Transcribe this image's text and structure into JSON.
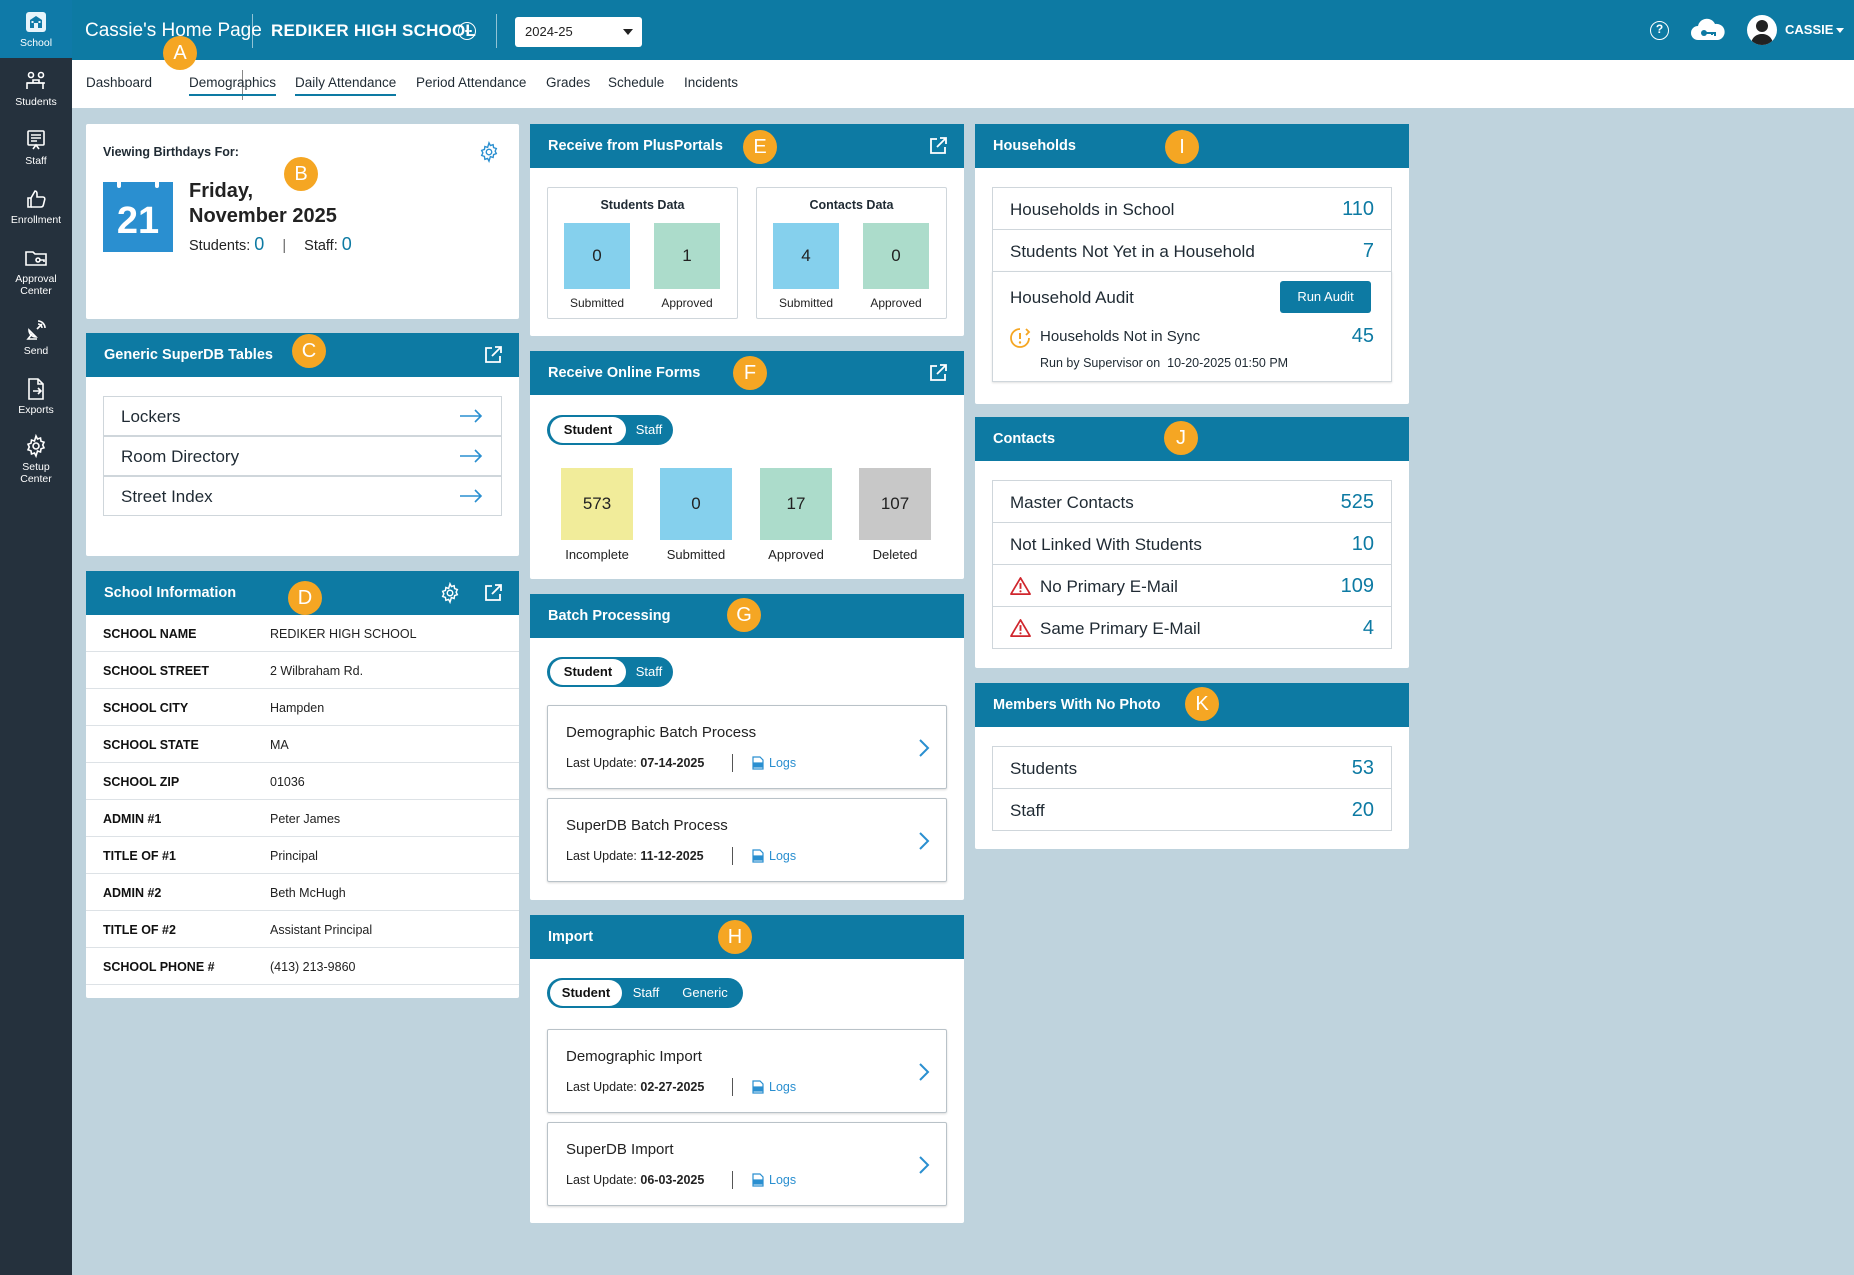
{
  "rail": {
    "items": [
      {
        "label": "School",
        "icon": "school-icon"
      },
      {
        "label": "Students",
        "icon": "students-icon"
      },
      {
        "label": "Staff",
        "icon": "staff-icon"
      },
      {
        "label": "Enrollment",
        "icon": "thumbs-up-icon"
      },
      {
        "label_line1": "Approval",
        "label_line2": "Center",
        "icon": "folder-key-icon"
      },
      {
        "label": "Send",
        "icon": "satellite-icon"
      },
      {
        "label": "Exports",
        "icon": "export-file-icon"
      },
      {
        "label_line1": "Setup",
        "label_line2": "Center",
        "icon": "gear-icon"
      }
    ]
  },
  "topbar": {
    "home_title": "Cassie's Home Page",
    "school_name": "REDIKER HIGH SCHOOL",
    "year": "2024-25",
    "user": "CASSIE",
    "help": "?"
  },
  "tabs": [
    "Dashboard",
    "Demographics",
    "Daily Attendance",
    "Period Attendance",
    "Grades",
    "Schedule",
    "Incidents"
  ],
  "badges": {
    "a": "A",
    "b": "B",
    "c": "C",
    "d": "D",
    "e": "E",
    "f": "F",
    "g": "G",
    "h": "H",
    "i": "I",
    "j": "J",
    "k": "K"
  },
  "birthdays": {
    "label": "Viewing Birthdays For:",
    "day": "21",
    "weekday": "Friday,",
    "month_year": "November 2025",
    "students_label": "Students:",
    "students": "0",
    "sep": "|",
    "staff_label": "Staff:",
    "staff": "0"
  },
  "superdb": {
    "title": "Generic SuperDB Tables",
    "items": [
      "Lockers",
      "Room Directory",
      "Street Index"
    ]
  },
  "school_info": {
    "title": "School Information",
    "rows": [
      {
        "k": "SCHOOL NAME",
        "v": "REDIKER HIGH SCHOOL"
      },
      {
        "k": "SCHOOL STREET",
        "v": "2 Wilbraham Rd."
      },
      {
        "k": "SCHOOL CITY",
        "v": "Hampden"
      },
      {
        "k": "SCHOOL STATE",
        "v": "MA"
      },
      {
        "k": "SCHOOL ZIP",
        "v": "01036"
      },
      {
        "k": "ADMIN #1",
        "v": "Peter James"
      },
      {
        "k": "TITLE OF #1",
        "v": "Principal"
      },
      {
        "k": "ADMIN #2",
        "v": "Beth McHugh"
      },
      {
        "k": "TITLE OF #2",
        "v": "Assistant Principal"
      },
      {
        "k": "SCHOOL PHONE #",
        "v": "(413) 213-9860"
      }
    ]
  },
  "plusportals": {
    "title": "Receive from PlusPortals",
    "students": {
      "title": "Students Data",
      "submitted": "0",
      "approved": "1",
      "submitted_label": "Submitted",
      "approved_label": "Approved"
    },
    "contacts": {
      "title": "Contacts Data",
      "submitted": "4",
      "approved": "0",
      "submitted_label": "Submitted",
      "approved_label": "Approved"
    }
  },
  "online_forms": {
    "title": "Receive Online Forms",
    "toggle": [
      "Student",
      "Staff"
    ],
    "tiles": [
      {
        "value": "573",
        "label": "Incomplete"
      },
      {
        "value": "0",
        "label": "Submitted"
      },
      {
        "value": "17",
        "label": "Approved"
      },
      {
        "value": "107",
        "label": "Deleted"
      }
    ]
  },
  "batch": {
    "title": "Batch Processing",
    "toggle": [
      "Student",
      "Staff"
    ],
    "items": [
      {
        "title": "Demographic Batch Process",
        "update_label": "Last Update:",
        "date": "07-14-2025",
        "logs": "Logs"
      },
      {
        "title": "SuperDB Batch Process",
        "update_label": "Last Update:",
        "date": "11-12-2025",
        "logs": "Logs"
      }
    ]
  },
  "import": {
    "title": "Import",
    "toggle": [
      "Student",
      "Staff",
      "Generic"
    ],
    "items": [
      {
        "title": "Demographic Import",
        "update_label": "Last Update:",
        "date": "02-27-2025",
        "logs": "Logs"
      },
      {
        "title": "SuperDB Import",
        "update_label": "Last Update:",
        "date": "06-03-2025",
        "logs": "Logs"
      }
    ]
  },
  "households": {
    "title": "Households",
    "in_school": {
      "label": "Households in School",
      "value": "110"
    },
    "not_in_household": {
      "label": "Students Not Yet in a Household",
      "value": "7"
    },
    "audit": {
      "label": "Household Audit",
      "button": "Run Audit",
      "sync_label": "Households Not in Sync",
      "sync_value": "45",
      "run_by": "Run by Supervisor on",
      "run_at": "10-20-2025 01:50 PM"
    }
  },
  "contacts": {
    "title": "Contacts",
    "rows": [
      {
        "label": "Master Contacts",
        "value": "525"
      },
      {
        "label": "Not Linked With Students",
        "value": "10"
      },
      {
        "label": "No Primary E-Mail",
        "value": "109"
      },
      {
        "label": "Same Primary E-Mail",
        "value": "4"
      }
    ]
  },
  "no_photo": {
    "title": "Members With No Photo",
    "rows": [
      {
        "label": "Students",
        "value": "53"
      },
      {
        "label": "Staff",
        "value": "20"
      }
    ]
  },
  "colors": {
    "primary": "#0d7aa3",
    "rail": "#25313d",
    "background": "#bfd3dd",
    "badge": "#f5a623",
    "warning": "#d0262d"
  }
}
